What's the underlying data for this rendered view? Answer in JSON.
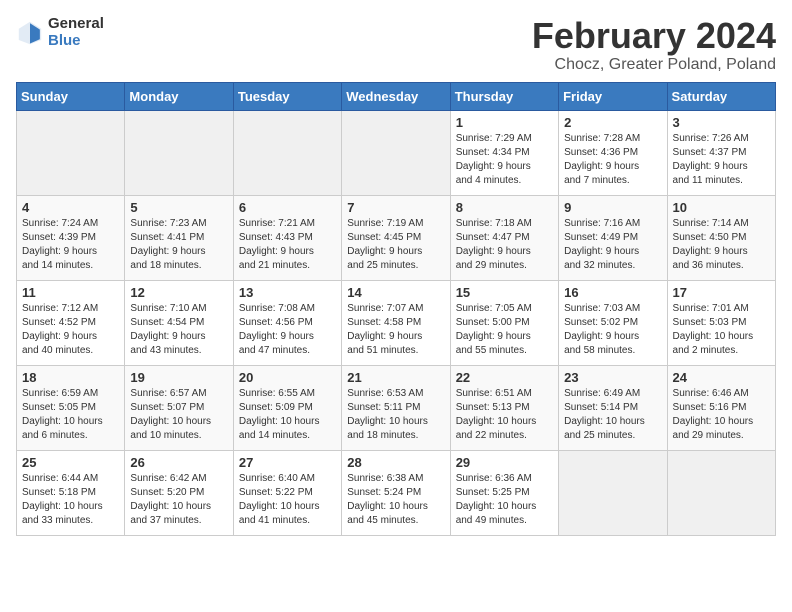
{
  "header": {
    "logo_general": "General",
    "logo_blue": "Blue",
    "title": "February 2024",
    "subtitle": "Chocz, Greater Poland, Poland"
  },
  "weekdays": [
    "Sunday",
    "Monday",
    "Tuesday",
    "Wednesday",
    "Thursday",
    "Friday",
    "Saturday"
  ],
  "weeks": [
    [
      {
        "day": "",
        "info": ""
      },
      {
        "day": "",
        "info": ""
      },
      {
        "day": "",
        "info": ""
      },
      {
        "day": "",
        "info": ""
      },
      {
        "day": "1",
        "info": "Sunrise: 7:29 AM\nSunset: 4:34 PM\nDaylight: 9 hours\nand 4 minutes."
      },
      {
        "day": "2",
        "info": "Sunrise: 7:28 AM\nSunset: 4:36 PM\nDaylight: 9 hours\nand 7 minutes."
      },
      {
        "day": "3",
        "info": "Sunrise: 7:26 AM\nSunset: 4:37 PM\nDaylight: 9 hours\nand 11 minutes."
      }
    ],
    [
      {
        "day": "4",
        "info": "Sunrise: 7:24 AM\nSunset: 4:39 PM\nDaylight: 9 hours\nand 14 minutes."
      },
      {
        "day": "5",
        "info": "Sunrise: 7:23 AM\nSunset: 4:41 PM\nDaylight: 9 hours\nand 18 minutes."
      },
      {
        "day": "6",
        "info": "Sunrise: 7:21 AM\nSunset: 4:43 PM\nDaylight: 9 hours\nand 21 minutes."
      },
      {
        "day": "7",
        "info": "Sunrise: 7:19 AM\nSunset: 4:45 PM\nDaylight: 9 hours\nand 25 minutes."
      },
      {
        "day": "8",
        "info": "Sunrise: 7:18 AM\nSunset: 4:47 PM\nDaylight: 9 hours\nand 29 minutes."
      },
      {
        "day": "9",
        "info": "Sunrise: 7:16 AM\nSunset: 4:49 PM\nDaylight: 9 hours\nand 32 minutes."
      },
      {
        "day": "10",
        "info": "Sunrise: 7:14 AM\nSunset: 4:50 PM\nDaylight: 9 hours\nand 36 minutes."
      }
    ],
    [
      {
        "day": "11",
        "info": "Sunrise: 7:12 AM\nSunset: 4:52 PM\nDaylight: 9 hours\nand 40 minutes."
      },
      {
        "day": "12",
        "info": "Sunrise: 7:10 AM\nSunset: 4:54 PM\nDaylight: 9 hours\nand 43 minutes."
      },
      {
        "day": "13",
        "info": "Sunrise: 7:08 AM\nSunset: 4:56 PM\nDaylight: 9 hours\nand 47 minutes."
      },
      {
        "day": "14",
        "info": "Sunrise: 7:07 AM\nSunset: 4:58 PM\nDaylight: 9 hours\nand 51 minutes."
      },
      {
        "day": "15",
        "info": "Sunrise: 7:05 AM\nSunset: 5:00 PM\nDaylight: 9 hours\nand 55 minutes."
      },
      {
        "day": "16",
        "info": "Sunrise: 7:03 AM\nSunset: 5:02 PM\nDaylight: 9 hours\nand 58 minutes."
      },
      {
        "day": "17",
        "info": "Sunrise: 7:01 AM\nSunset: 5:03 PM\nDaylight: 10 hours\nand 2 minutes."
      }
    ],
    [
      {
        "day": "18",
        "info": "Sunrise: 6:59 AM\nSunset: 5:05 PM\nDaylight: 10 hours\nand 6 minutes."
      },
      {
        "day": "19",
        "info": "Sunrise: 6:57 AM\nSunset: 5:07 PM\nDaylight: 10 hours\nand 10 minutes."
      },
      {
        "day": "20",
        "info": "Sunrise: 6:55 AM\nSunset: 5:09 PM\nDaylight: 10 hours\nand 14 minutes."
      },
      {
        "day": "21",
        "info": "Sunrise: 6:53 AM\nSunset: 5:11 PM\nDaylight: 10 hours\nand 18 minutes."
      },
      {
        "day": "22",
        "info": "Sunrise: 6:51 AM\nSunset: 5:13 PM\nDaylight: 10 hours\nand 22 minutes."
      },
      {
        "day": "23",
        "info": "Sunrise: 6:49 AM\nSunset: 5:14 PM\nDaylight: 10 hours\nand 25 minutes."
      },
      {
        "day": "24",
        "info": "Sunrise: 6:46 AM\nSunset: 5:16 PM\nDaylight: 10 hours\nand 29 minutes."
      }
    ],
    [
      {
        "day": "25",
        "info": "Sunrise: 6:44 AM\nSunset: 5:18 PM\nDaylight: 10 hours\nand 33 minutes."
      },
      {
        "day": "26",
        "info": "Sunrise: 6:42 AM\nSunset: 5:20 PM\nDaylight: 10 hours\nand 37 minutes."
      },
      {
        "day": "27",
        "info": "Sunrise: 6:40 AM\nSunset: 5:22 PM\nDaylight: 10 hours\nand 41 minutes."
      },
      {
        "day": "28",
        "info": "Sunrise: 6:38 AM\nSunset: 5:24 PM\nDaylight: 10 hours\nand 45 minutes."
      },
      {
        "day": "29",
        "info": "Sunrise: 6:36 AM\nSunset: 5:25 PM\nDaylight: 10 hours\nand 49 minutes."
      },
      {
        "day": "",
        "info": ""
      },
      {
        "day": "",
        "info": ""
      }
    ]
  ]
}
